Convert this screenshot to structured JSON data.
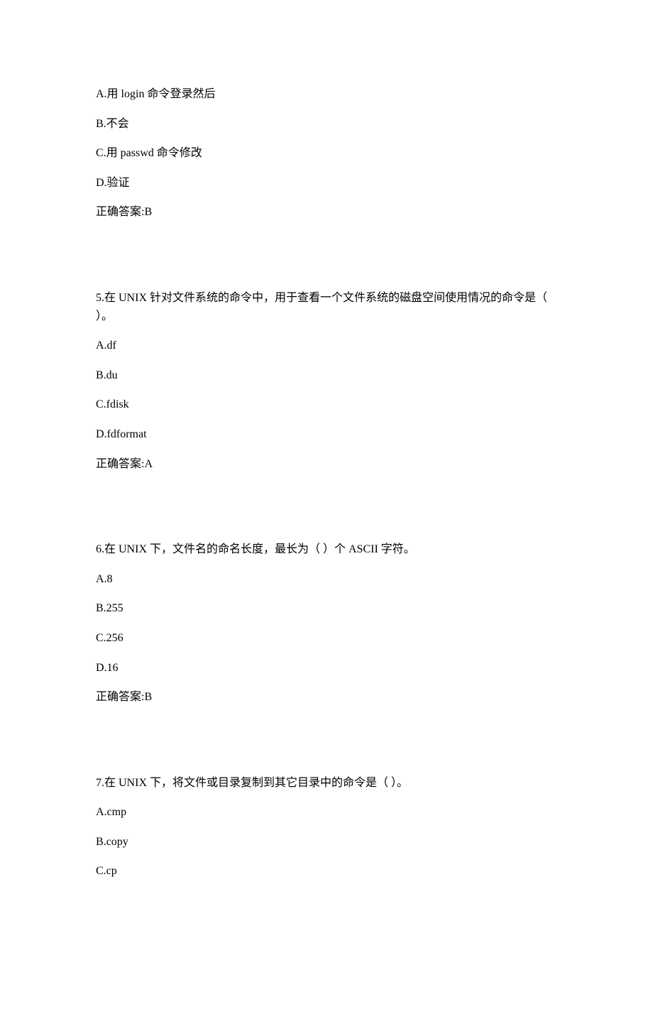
{
  "partial_question": {
    "options": [
      "A.用 login 命令登录然后",
      "B.不会",
      "C.用 passwd 命令修改",
      "D.验证"
    ],
    "answer": "正确答案:B"
  },
  "questions": [
    {
      "question": "5.在 UNIX 针对文件系统的命令中，用于查看一个文件系统的磁盘空间使用情况的命令是（  ）。",
      "options": [
        "A.df",
        "B.du",
        "C.fdisk",
        "D.fdformat"
      ],
      "answer": "正确答案:A"
    },
    {
      "question": "6.在 UNIX 下，文件名的命名长度，最长为（  ）个 ASCII 字符。",
      "options": [
        "A.8",
        "B.255",
        "C.256",
        "D.16"
      ],
      "answer": "正确答案:B"
    },
    {
      "question": "7.在 UNIX 下，将文件或目录复制到其它目录中的命令是（  ）。",
      "options": [
        "A.cmp",
        "B.copy",
        "C.cp"
      ],
      "answer": ""
    }
  ]
}
